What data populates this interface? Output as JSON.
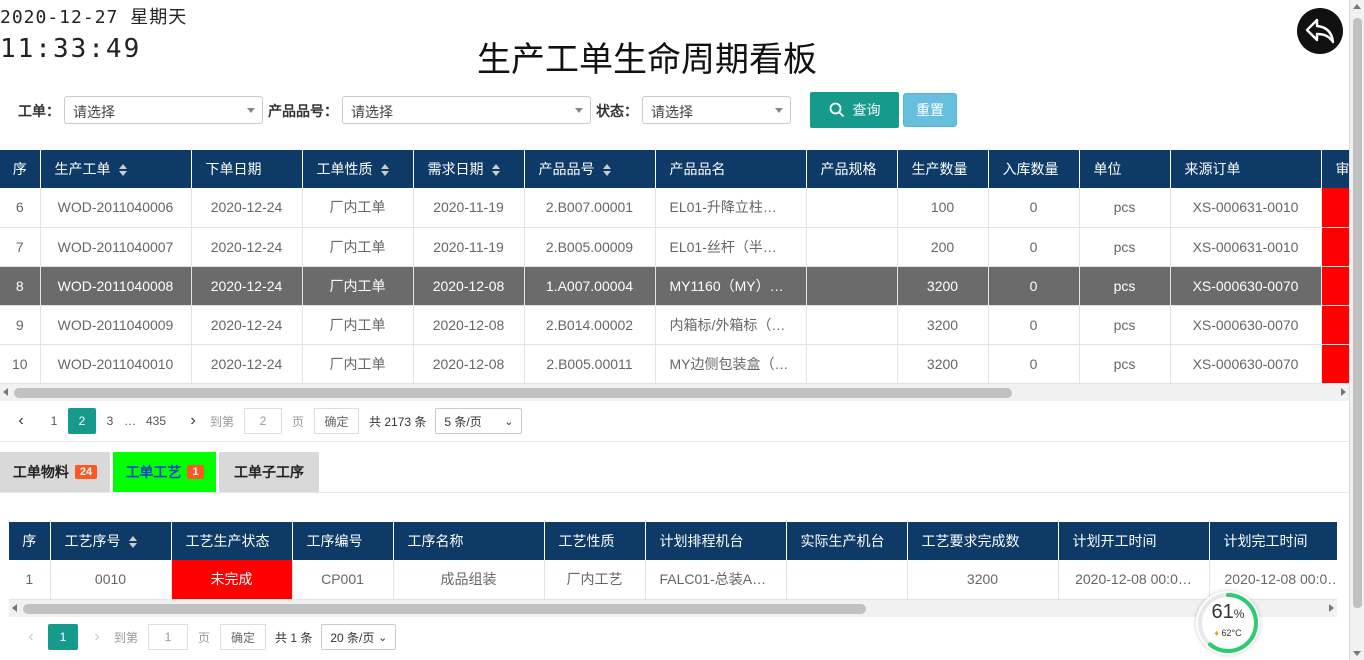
{
  "header": {
    "date": "2020-12-27 星期天",
    "time": "11:33:49",
    "title": "生产工单生命周期看板"
  },
  "filters": {
    "order_label": "工单：",
    "order_placeholder": "请选择",
    "product_no_label": "产品品号：",
    "product_no_placeholder": "请选择",
    "status_label": "状态：",
    "status_placeholder": "请选择",
    "query_label": "查询",
    "reset_label": "重置"
  },
  "main_table": {
    "columns": [
      "序",
      "生产工单",
      "下单日期",
      "工单性质",
      "需求日期",
      "产品品号",
      "产品品名",
      "产品规格",
      "生产数量",
      "入库数量",
      "单位",
      "来源订单",
      "审"
    ],
    "rows": [
      [
        "6",
        "WOD-2011040006",
        "2020-12-24",
        "厂内工单",
        "2020-11-19",
        "2.B007.00001",
        "EL01-升降立柱…",
        "",
        "100",
        "0",
        "pcs",
        "XS-000631-0010"
      ],
      [
        "7",
        "WOD-2011040007",
        "2020-12-24",
        "厂内工单",
        "2020-11-19",
        "2.B005.00009",
        "EL01-丝杆（半…",
        "",
        "200",
        "0",
        "pcs",
        "XS-000631-0010"
      ],
      [
        "8",
        "WOD-2011040008",
        "2020-12-24",
        "厂内工单",
        "2020-12-08",
        "1.A007.00004",
        "MY1160（MY）…",
        "",
        "3200",
        "0",
        "pcs",
        "XS-000630-0070"
      ],
      [
        "9",
        "WOD-2011040009",
        "2020-12-24",
        "厂内工单",
        "2020-12-08",
        "2.B014.00002",
        "内箱标/外箱标（…",
        "",
        "3200",
        "0",
        "pcs",
        "XS-000630-0070"
      ],
      [
        "10",
        "WOD-2011040010",
        "2020-12-24",
        "厂内工单",
        "2020-12-08",
        "2.B005.00011",
        "MY边侧包装盒（…",
        "",
        "3200",
        "0",
        "pcs",
        "XS-000630-0070"
      ]
    ],
    "selected_row": 2,
    "status_color": "#ff0000"
  },
  "main_pager": {
    "pages": [
      "1",
      "2",
      "3",
      "…",
      "435"
    ],
    "current": "2",
    "goto_label": "到第",
    "goto_value": "2",
    "page_unit": "页",
    "confirm_label": "确定",
    "total": "共 2173 条",
    "page_size": "5 条/页"
  },
  "tabs": [
    {
      "label": "工单物料",
      "badge": "24",
      "active": false
    },
    {
      "label": "工单工艺",
      "badge": "1",
      "active": true
    },
    {
      "label": "工单子工序",
      "badge": "",
      "active": false
    }
  ],
  "process_table": {
    "columns": [
      "序",
      "工艺序号",
      "工艺生产状态",
      "工序编号",
      "工序名称",
      "工艺性质",
      "计划排程机台",
      "实际生产机台",
      "工艺要求完成数",
      "计划开工时间",
      "计划完工时间"
    ],
    "rows": [
      [
        "1",
        "0010",
        "未完成",
        "CP001",
        "成品组装",
        "厂内工艺",
        "FALC01-总装A…",
        "",
        "3200",
        "2020-12-08 00:0…",
        "2020-12-08 00:0…"
      ]
    ]
  },
  "process_pager": {
    "pages": [
      "1"
    ],
    "current": "1",
    "goto_label": "到第",
    "goto_value": "1",
    "page_unit": "页",
    "confirm_label": "确定",
    "total": "共 1 条",
    "page_size": "20 条/页"
  },
  "monitor": {
    "percent": "61",
    "percent_unit": "%",
    "temperature": "62°C",
    "ring_color": "#2ecc71"
  },
  "icons": {
    "back": "back-arrow-icon",
    "search": "search-icon",
    "temperature": "flame-icon"
  }
}
